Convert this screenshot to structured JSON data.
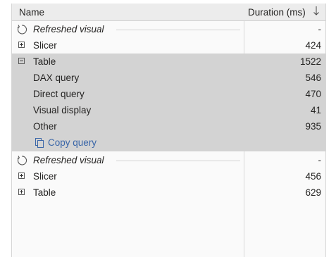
{
  "columns": {
    "name": "Name",
    "duration": "Duration (ms)"
  },
  "sort_icon": "arrow-down-icon",
  "rows": [
    {
      "label": "Refreshed visual",
      "value": "-",
      "kind": "refresh"
    },
    {
      "label": "Slicer",
      "value": "424",
      "kind": "collapsed"
    },
    {
      "label": "Table",
      "value": "1522",
      "kind": "expanded"
    },
    {
      "label": "DAX query",
      "value": "546",
      "kind": "child"
    },
    {
      "label": "Direct query",
      "value": "470",
      "kind": "child"
    },
    {
      "label": "Visual display",
      "value": "41",
      "kind": "child"
    },
    {
      "label": "Other",
      "value": "935",
      "kind": "child"
    },
    {
      "label": "Copy query",
      "kind": "link"
    },
    {
      "label": "Refreshed visual",
      "value": "-",
      "kind": "refresh"
    },
    {
      "label": "Slicer",
      "value": "456",
      "kind": "collapsed"
    },
    {
      "label": "Table",
      "value": "629",
      "kind": "collapsed"
    }
  ],
  "colors": {
    "highlight": "#d3d3d3",
    "link": "#3a66a8",
    "header": "#ececec"
  }
}
